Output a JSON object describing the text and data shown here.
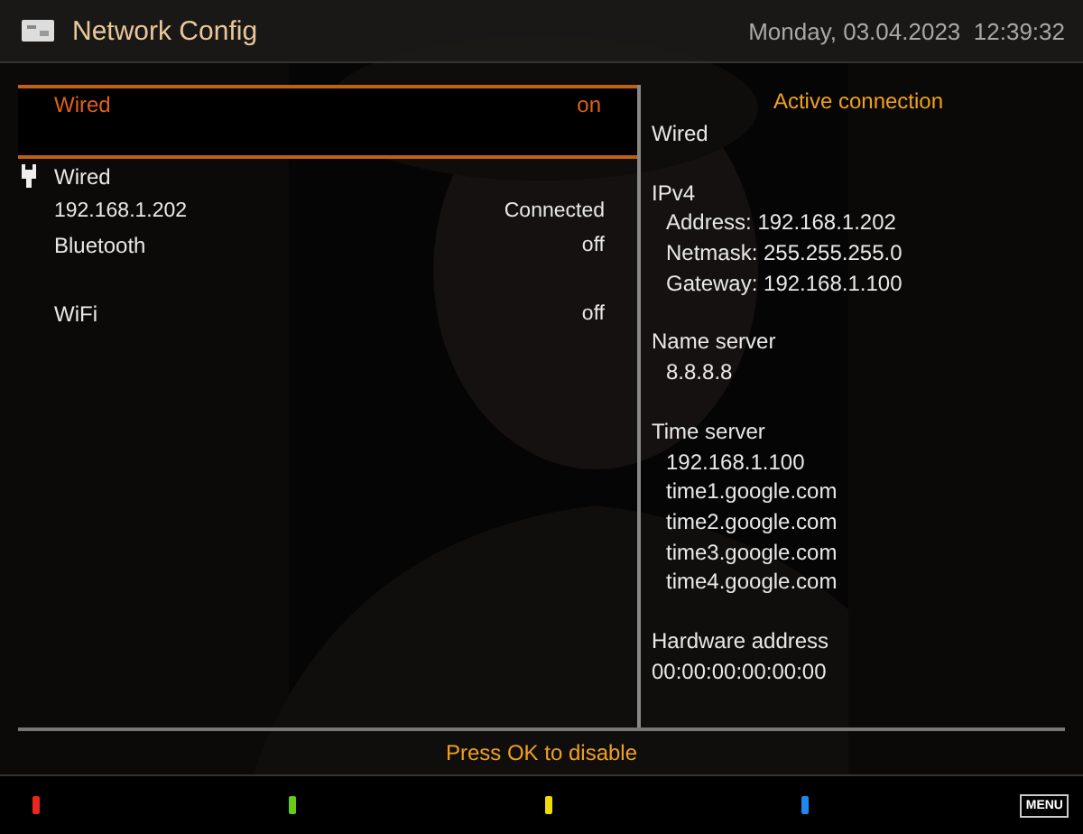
{
  "header": {
    "title": "Network Config",
    "datetime": "Monday, 03.04.2023  12:39:32"
  },
  "setting": {
    "label": "Wired",
    "value": "on"
  },
  "interfaces": [
    {
      "label": "Wired",
      "kind": "adapter",
      "icon": true,
      "gap_before": false
    },
    {
      "label": "192.168.1.202",
      "value": "Connected",
      "kind": "detail",
      "gap_before": false
    },
    {
      "label": "Bluetooth",
      "value": "off",
      "kind": "adapter",
      "gap_before": false
    },
    {
      "label": "WiFi",
      "value": "off",
      "kind": "adapter",
      "gap_before": true
    }
  ],
  "details": {
    "title": "Active connection",
    "sections": [
      {
        "heading": "Wired"
      },
      {
        "heading": "IPv4",
        "lines": [
          "Address: 192.168.1.202",
          "Netmask: 255.255.255.0",
          "Gateway: 192.168.1.100"
        ]
      },
      {
        "heading": "Name server",
        "lines": [
          "8.8.8.8"
        ]
      },
      {
        "heading": "Time server",
        "lines": [
          "192.168.1.100",
          "time1.google.com",
          "time2.google.com",
          "time3.google.com",
          "time4.google.com"
        ]
      },
      {
        "heading": "Hardware address",
        "value": "00:00:00:00:00:00"
      }
    ]
  },
  "hint": "Press OK to disable",
  "color_keys": [
    {
      "color": "#e8281e"
    },
    {
      "color": "#66cc11"
    },
    {
      "color": "#eedd00"
    },
    {
      "color": "#1e88ee"
    }
  ],
  "menu_key": "MENU"
}
